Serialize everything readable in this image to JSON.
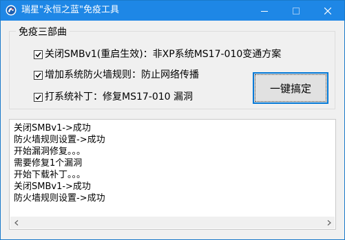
{
  "window": {
    "title": "瑞星\"永恒之蓝\"免疫工具",
    "icon": "ruixing-lion-logo-icon",
    "controls": [
      "minimize-icon",
      "maximize-icon",
      "close-icon"
    ]
  },
  "group": {
    "title": "免疫三部曲",
    "items": [
      {
        "label": "关闭SMBv1(重启生效)：非XP系统MS17-010变通方案",
        "checked": true
      },
      {
        "label": "增加系统防火墙规则：防止网络传播",
        "checked": true
      },
      {
        "label": "打系统补丁：修复MS17-010 漏洞",
        "checked": true
      }
    ]
  },
  "action_button": {
    "label": "一键搞定"
  },
  "log": {
    "lines": [
      "关闭SMBv1->成功",
      "防火墙规则设置->成功",
      "开始漏洞修复。。。",
      "需要修复1个漏洞",
      "开始下载补丁。。。",
      "关闭SMBv1->成功",
      "防火墙规则设置->成功"
    ]
  },
  "colors": {
    "titlebar": "#1e87e6",
    "window_bg": "#f0f0f0",
    "button_border": "#0078d7"
  }
}
